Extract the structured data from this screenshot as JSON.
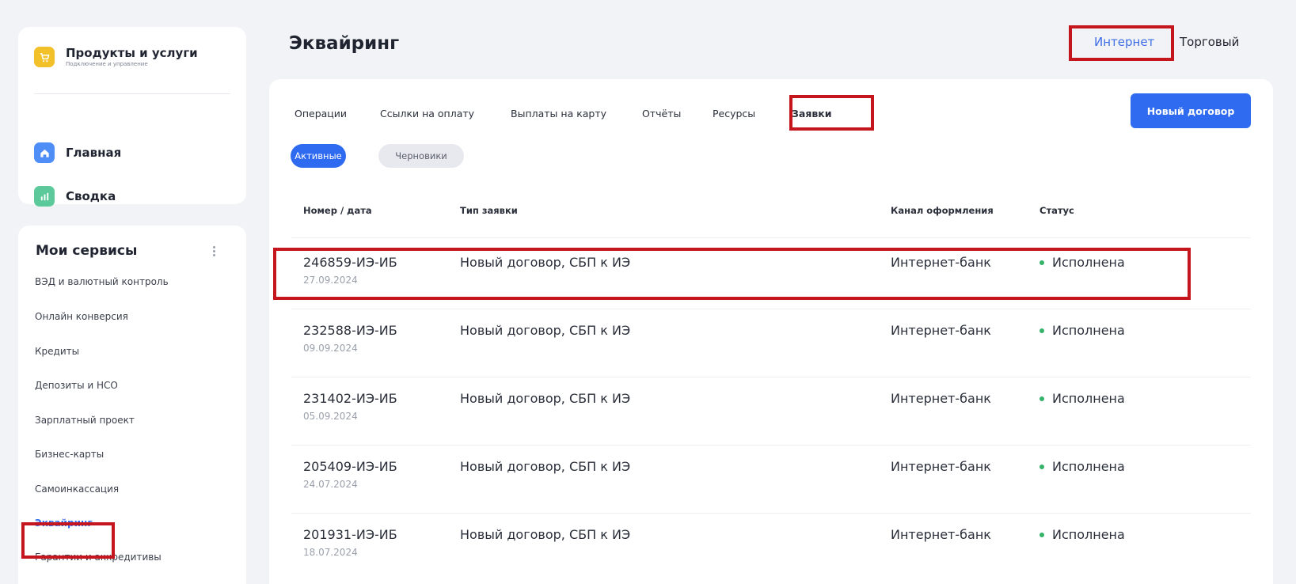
{
  "sidebar": {
    "products": {
      "title": "Продукты и услуги",
      "subtitle": "Подключение и управление",
      "icon": "cart-icon",
      "icon_color": "#f2c028"
    },
    "nav": [
      {
        "label": "Главная",
        "icon": "home-icon",
        "icon_color": "#4f8ef7"
      },
      {
        "label": "Сводка",
        "icon": "chart-icon",
        "icon_color": "#5cc99a"
      }
    ],
    "services": {
      "title": "Мои сервисы",
      "items": [
        {
          "label": "ВЭД и валютный контроль"
        },
        {
          "label": "Онлайн конверсия"
        },
        {
          "label": "Кредиты"
        },
        {
          "label": "Депозиты и НСО"
        },
        {
          "label": "Зарплатный проект"
        },
        {
          "label": "Бизнес-карты"
        },
        {
          "label": "Самоинкассация"
        },
        {
          "label": "Эквайринг",
          "active": true
        },
        {
          "label": "Гарантии и аккредитивы"
        }
      ]
    }
  },
  "header": {
    "title": "Эквайринг",
    "modes": [
      "Интернет",
      "Торговый"
    ],
    "active_mode": "Интернет"
  },
  "tabs": [
    {
      "label": "Операции"
    },
    {
      "label": "Ссылки на оплату"
    },
    {
      "label": "Выплаты на карту"
    },
    {
      "label": "Отчёты"
    },
    {
      "label": "Ресурсы"
    },
    {
      "label": "Заявки",
      "active": true
    }
  ],
  "new_contract_button": "Новый договор",
  "filters": {
    "active": "Активные",
    "drafts": "Черновики"
  },
  "table": {
    "columns": [
      "Номер / дата",
      "Тип заявки",
      "Канал оформления",
      "Статус"
    ],
    "rows": [
      {
        "number": "246859-ИЭ-ИБ",
        "date": "27.09.2024",
        "type": "Новый договор, СБП к ИЭ",
        "channel": "Интернет-банк",
        "status": "Исполнена"
      },
      {
        "number": "232588-ИЭ-ИБ",
        "date": "09.09.2024",
        "type": "Новый договор, СБП к ИЭ",
        "channel": "Интернет-банк",
        "status": "Исполнена"
      },
      {
        "number": "231402-ИЭ-ИБ",
        "date": "05.09.2024",
        "type": "Новый договор, СБП к ИЭ",
        "channel": "Интернет-банк",
        "status": "Исполнена"
      },
      {
        "number": "205409-ИЭ-ИБ",
        "date": "24.07.2024",
        "type": "Новый договор, СБП к ИЭ",
        "channel": "Интернет-банк",
        "status": "Исполнена"
      },
      {
        "number": "201931-ИЭ-ИБ",
        "date": "18.07.2024",
        "type": "Новый договор, СБП к ИЭ",
        "channel": "Интернет-банк",
        "status": "Исполнена"
      }
    ]
  },
  "colors": {
    "accent": "#2f6bf0",
    "status_ok": "#36b36a",
    "highlight": "#c4161c"
  }
}
